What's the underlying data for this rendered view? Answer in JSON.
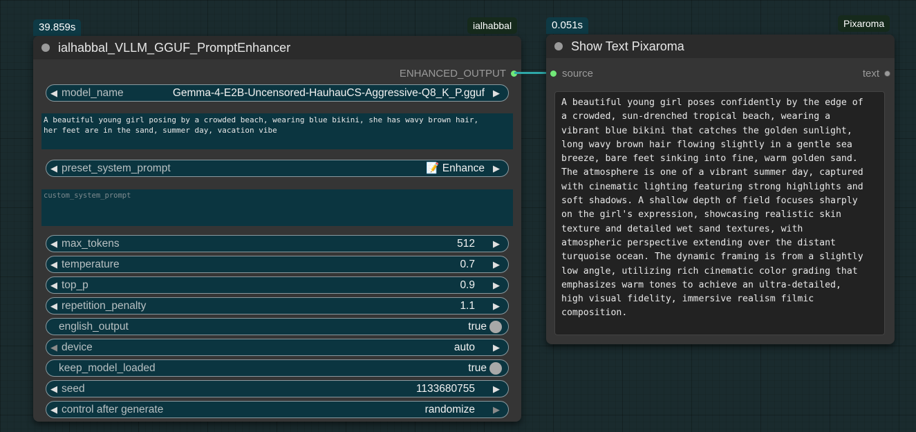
{
  "node_left": {
    "time_badge": "39.859s",
    "author_badge": "ialhabbal",
    "title": "ialhabbal_VLLM_GGUF_PromptEnhancer",
    "output_label": "ENHANCED_OUTPUT",
    "model_name": {
      "label": "model_name",
      "value": "Gemma-4-E2B-Uncensored-HauhauCS-Aggressive-Q8_K_P.gguf"
    },
    "prompt_text": "A beautiful young girl posing by a crowded beach, wearing blue bikini, she has wavy brown hair,\nher feet are in the sand, summer day, vacation vibe",
    "preset_system_prompt": {
      "label": "preset_system_prompt",
      "value": "📝 Enhance"
    },
    "custom_system_prompt_placeholder": "custom_system_prompt",
    "max_tokens": {
      "label": "max_tokens",
      "value": "512"
    },
    "temperature": {
      "label": "temperature",
      "value": "0.7"
    },
    "top_p": {
      "label": "top_p",
      "value": "0.9"
    },
    "repetition_penalty": {
      "label": "repetition_penalty",
      "value": "1.1"
    },
    "english_output": {
      "label": "english_output",
      "value": "true"
    },
    "device": {
      "label": "device",
      "value": "auto"
    },
    "keep_model_loaded": {
      "label": "keep_model_loaded",
      "value": "true"
    },
    "seed": {
      "label": "seed",
      "value": "1133680755"
    },
    "control_after_generate": {
      "label": "control after generate",
      "value": "randomize"
    }
  },
  "node_right": {
    "time_badge": "0.051s",
    "author_badge": "Pixaroma",
    "title": "Show Text Pixaroma",
    "input_label": "source",
    "output_label": "text",
    "text": "A beautiful young girl poses confidently by the edge of\na crowded, sun-drenched tropical beach, wearing a\nvibrant blue bikini that catches the golden sunlight,\nlong wavy brown hair flowing slightly in a gentle sea\nbreeze, bare feet sinking into fine, warm golden sand.\nThe atmosphere is one of a vibrant summer day, captured\nwith cinematic lighting featuring strong highlights and\nsoft shadows. A shallow depth of field focuses sharply\non the girl's expression, showcasing realistic skin\ntexture and detailed wet sand textures, with\natmospheric perspective extending over the distant\nturquoise ocean. The dynamic framing is from a slightly\nlow angle, utilizing rich cinematic color grading that\nemphasizes warm tones to achieve an ultra-detailed,\nhigh visual fidelity, immersive realism filmic\ncomposition."
  },
  "colors": {
    "accent_link": "#2ea8a8",
    "socket_green": "#72e878",
    "widget_bg": "#0b3540"
  },
  "icons": {
    "arrow_left": "◀",
    "arrow_right": "▶"
  }
}
